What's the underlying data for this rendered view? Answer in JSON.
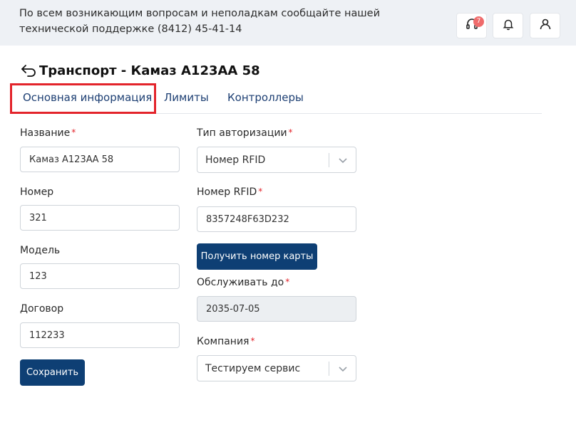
{
  "header": {
    "support_text": "По всем возникающим вопросам и неполадкам сообщайте нашей технической поддержке (8412) 45-41-14",
    "support_badge": "7"
  },
  "page": {
    "title": "Транспорт - Камаз А123АА 58"
  },
  "tabs": [
    {
      "label": "Основная информация"
    },
    {
      "label": "Лимиты"
    },
    {
      "label": "Контроллеры"
    }
  ],
  "form": {
    "name_label": "Название",
    "name_value": "Камаз А123АА 58",
    "number_label": "Номер",
    "number_value": "321",
    "model_label": "Модель",
    "model_value": "123",
    "contract_label": "Договор",
    "contract_value": "112233",
    "save_label": "Сохранить",
    "auth_type_label": "Тип авторизации",
    "auth_type_value": "Номер RFID",
    "rfid_label": "Номер RFID",
    "rfid_value": "8357248F63D232",
    "get_card_label": "Получить номер карты",
    "service_until_label": "Обслуживать до",
    "service_until_value": "2035-07-05",
    "company_label": "Компания",
    "company_value": "Тестируем сервис",
    "required_mark": "*"
  },
  "colors": {
    "primary": "#0e3f74",
    "required": "#e3242b",
    "tab_text": "#1d3f73",
    "highlight": "#e3242b"
  }
}
